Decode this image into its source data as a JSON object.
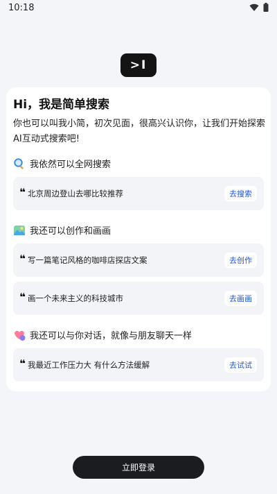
{
  "status_bar": {
    "time": "10:18"
  },
  "logo": {
    "label": ">I"
  },
  "card": {
    "title": "Hi，我是简单搜索",
    "intro": "你也可以叫我小简，初次见面，很高兴认识你，让我们开始探索AI互动式搜索吧!"
  },
  "sections": [
    {
      "heading": "我依然可以全网搜索",
      "icon": "magnifier-icon",
      "items": [
        {
          "quote": "❝",
          "text": "北京周边登山去哪比较推荐",
          "action": "去搜索"
        }
      ]
    },
    {
      "heading": "我还可以创作和画画",
      "icon": "picture-icon",
      "items": [
        {
          "quote": "❝",
          "text": "写一篇笔记风格的咖啡店探店文案",
          "action": "去创作"
        },
        {
          "quote": "❝",
          "text": "画一个未来主义的科技城市",
          "action": "去画画"
        }
      ]
    },
    {
      "heading": "我还可以与你对话，就像与朋友聊天一样",
      "icon": "chat-bubbles-icon",
      "items": [
        {
          "quote": "❝",
          "text": "我最近工作压力大 有什么方法缓解",
          "action": "去试试"
        }
      ]
    }
  ],
  "login": {
    "label": "立即登录"
  }
}
